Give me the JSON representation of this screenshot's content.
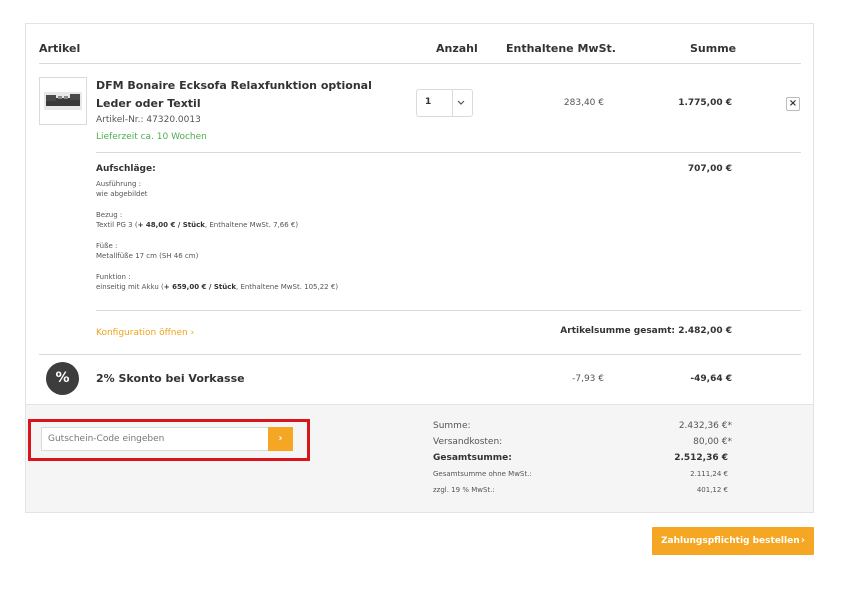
{
  "header": {
    "artikel": "Artikel",
    "anzahl": "Anzahl",
    "mwst": "Enthaltene MwSt.",
    "summe": "Summe"
  },
  "product": {
    "name": "DFM Bonaire Ecksofa Relaxfunktion optional Leder oder Textil",
    "article_no": "Artikel-Nr.: 47320.0013",
    "delivery": "Lieferzeit ca. 10 Wochen",
    "quantity": "1",
    "mwst": "283,40 €",
    "sum": "1.775,00 €",
    "remove": "×"
  },
  "surcharges": {
    "title": "Aufschläge:",
    "total": "707,00 €",
    "items": [
      {
        "label": "Ausführung :",
        "value": "wie abgebildet",
        "bold": "",
        "rest": ""
      },
      {
        "label": "Bezug :",
        "value": "Textil PG 3 (",
        "bold": "+ 48,00 € / Stück",
        "rest": ", Enthaltene MwSt. 7,66 €)"
      },
      {
        "label": "Füße :",
        "value": "Metallfüße 17 cm (SH 46 cm)",
        "bold": "",
        "rest": ""
      },
      {
        "label": "Funktion :",
        "value": "einseitig mit Akku (",
        "bold": "+ 659,00 € / Stück",
        "rest": ", Enthaltene MwSt. 105,22 €)"
      }
    ]
  },
  "config": {
    "link": "Konfiguration öffnen",
    "link_arrow": "›",
    "total_label": "Artikelsumme gesamt:",
    "total_value": "2.482,00 €"
  },
  "discount": {
    "icon": "%",
    "label": "2% Skonto bei Vorkasse",
    "mwst": "-7,93 €",
    "sum": "-49,64 €"
  },
  "voucher": {
    "placeholder": "Gutschein-Code eingeben",
    "button": "›"
  },
  "totals": [
    {
      "label": "Summe:",
      "value": "2.432,36 €*",
      "style": ""
    },
    {
      "label": "Versandkosten:",
      "value": "80,00 €*",
      "style": ""
    },
    {
      "label": "Gesamtsumme:",
      "value": "2.512,36 €",
      "style": "b"
    },
    {
      "label": "Gesamtsumme ohne MwSt.:",
      "value": "2.111,24 €",
      "style": "t"
    },
    {
      "label": "zzgl. 19 % MwSt.:",
      "value": "401,12 €",
      "style": "t"
    }
  ],
  "order_button": {
    "label": "Zahlungspflichtig bestellen",
    "arrow": "›"
  },
  "colors": {
    "accent": "#f5a623",
    "highlight": "#d9141b",
    "delivery_green": "#4caf50"
  }
}
